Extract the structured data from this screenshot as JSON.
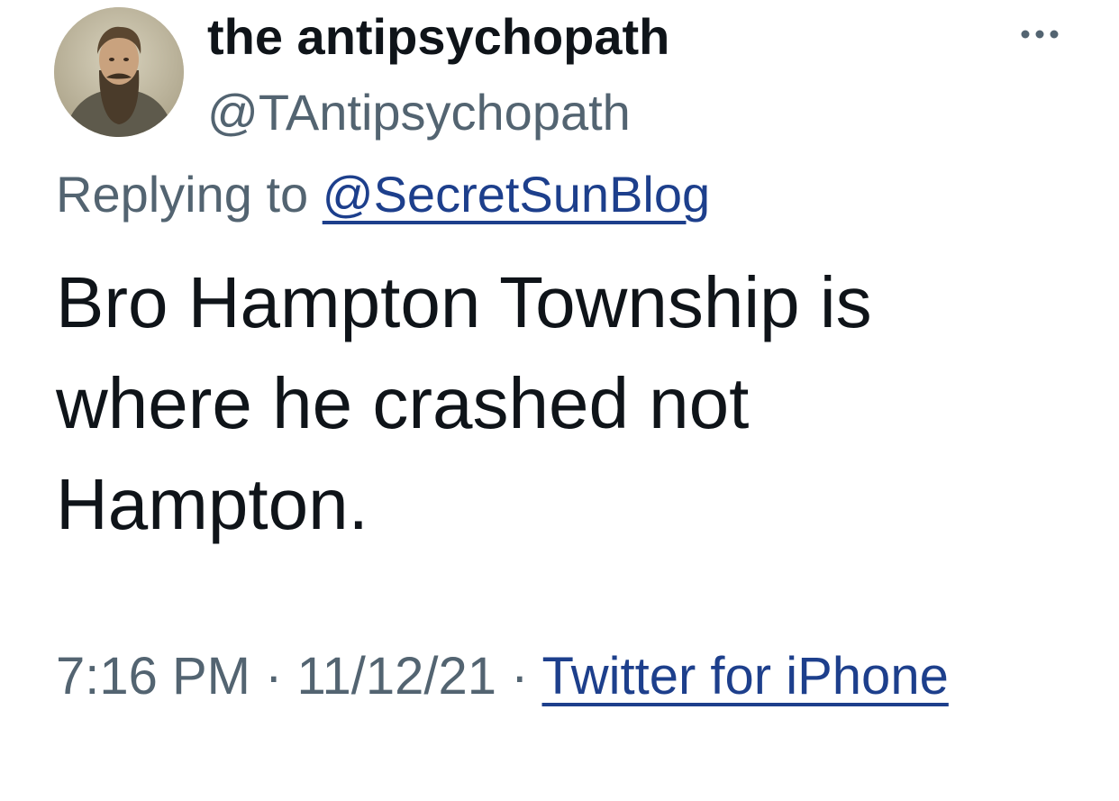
{
  "author": {
    "display_name": "the antipsychopath",
    "handle": "@TAntipsychopath",
    "avatar_icon": "portrait-avatar"
  },
  "menu": {
    "more_icon": "ellipsis-icon"
  },
  "reply": {
    "prefix": "Replying to ",
    "to_handle": "@SecretSunBlog"
  },
  "tweet": {
    "text": "Bro Hampton Township is where he crashed not Hampton."
  },
  "meta": {
    "time": "7:16 PM",
    "separator1": " · ",
    "date": "11/12/21",
    "separator2": " · ",
    "source": "Twitter for iPhone"
  },
  "colors": {
    "text_primary": "#0f1419",
    "text_secondary": "#536471",
    "link": "#1d3f8c"
  }
}
